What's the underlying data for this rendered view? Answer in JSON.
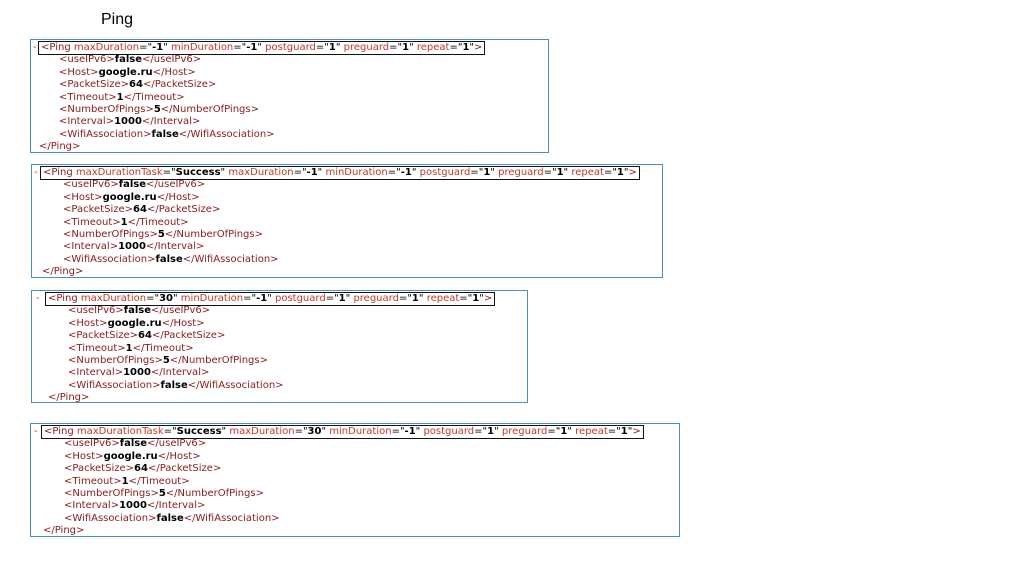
{
  "page": {
    "title": "Ping"
  },
  "collapse_symbol": "-",
  "blocks": [
    {
      "attrs": [
        {
          "name": "maxDuration",
          "value": "-1"
        },
        {
          "name": "minDuration",
          "value": "-1"
        },
        {
          "name": "postguard",
          "value": "1"
        },
        {
          "name": "preguard",
          "value": "1"
        },
        {
          "name": "repeat",
          "value": "1"
        }
      ],
      "tag": "Ping",
      "children": [
        {
          "tag": "useIPv6",
          "value": "false"
        },
        {
          "tag": "Host",
          "value": "google.ru"
        },
        {
          "tag": "PacketSize",
          "value": "64"
        },
        {
          "tag": "Timeout",
          "value": "1"
        },
        {
          "tag": "NumberOfPings",
          "value": "5"
        },
        {
          "tag": "Interval",
          "value": "1000"
        },
        {
          "tag": "WifiAssociation",
          "value": "false"
        }
      ]
    },
    {
      "attrs": [
        {
          "name": "maxDurationTask",
          "value": "Success"
        },
        {
          "name": "maxDuration",
          "value": "-1"
        },
        {
          "name": "minDuration",
          "value": "-1"
        },
        {
          "name": "postguard",
          "value": "1"
        },
        {
          "name": "preguard",
          "value": "1"
        },
        {
          "name": "repeat",
          "value": "1"
        }
      ],
      "tag": "Ping",
      "children": [
        {
          "tag": "useIPv6",
          "value": "false"
        },
        {
          "tag": "Host",
          "value": "google.ru"
        },
        {
          "tag": "PacketSize",
          "value": "64"
        },
        {
          "tag": "Timeout",
          "value": "1"
        },
        {
          "tag": "NumberOfPings",
          "value": "5"
        },
        {
          "tag": "Interval",
          "value": "1000"
        },
        {
          "tag": "WifiAssociation",
          "value": "false"
        }
      ]
    },
    {
      "attrs": [
        {
          "name": "maxDuration",
          "value": "30"
        },
        {
          "name": "minDuration",
          "value": "-1"
        },
        {
          "name": "postguard",
          "value": "1"
        },
        {
          "name": "preguard",
          "value": "1"
        },
        {
          "name": "repeat",
          "value": "1"
        }
      ],
      "tag": "Ping",
      "children": [
        {
          "tag": "useIPv6",
          "value": "false"
        },
        {
          "tag": "Host",
          "value": "google.ru"
        },
        {
          "tag": "PacketSize",
          "value": "64"
        },
        {
          "tag": "Timeout",
          "value": "1"
        },
        {
          "tag": "NumberOfPings",
          "value": "5"
        },
        {
          "tag": "Interval",
          "value": "1000"
        },
        {
          "tag": "WifiAssociation",
          "value": "false"
        }
      ]
    },
    {
      "attrs": [
        {
          "name": "maxDurationTask",
          "value": "Success"
        },
        {
          "name": "maxDuration",
          "value": "30"
        },
        {
          "name": "minDuration",
          "value": "-1"
        },
        {
          "name": "postguard",
          "value": "1"
        },
        {
          "name": "preguard",
          "value": "1"
        },
        {
          "name": "repeat",
          "value": "1"
        }
      ],
      "tag": "Ping",
      "children": [
        {
          "tag": "useIPv6",
          "value": "false"
        },
        {
          "tag": "Host",
          "value": "google.ru"
        },
        {
          "tag": "PacketSize",
          "value": "64"
        },
        {
          "tag": "Timeout",
          "value": "1"
        },
        {
          "tag": "NumberOfPings",
          "value": "5"
        },
        {
          "tag": "Interval",
          "value": "1000"
        },
        {
          "tag": "WifiAssociation",
          "value": "false"
        }
      ]
    }
  ]
}
